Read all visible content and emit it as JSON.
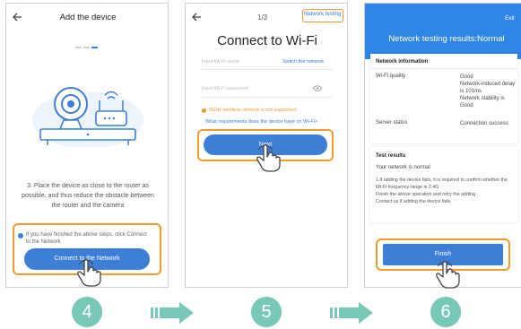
{
  "colors": {
    "accent": "#3d7fd6",
    "highlight": "#f29a2e",
    "step": "#78c8b8"
  },
  "screen1": {
    "back_icon": "back-arrow-icon",
    "title": "Add the device",
    "instruction": "3. Place the device as close to the router as possible, and thus reduce the obstacle between the router and the camera",
    "checkbox_label": "If you have finished the above steps, click Connect to the Network",
    "connect_button": "Connect to the Network"
  },
  "screen2": {
    "back_icon": "back-arrow-icon",
    "page_indicator": "1/3",
    "network_testing_link": "Network testing",
    "title": "Connect to Wi-Fi",
    "wifi_name_placeholder": "Input Wi-Fi name",
    "switch_network": "Switch the network",
    "wifi_password_placeholder": "Input Wi-Fi password",
    "warning": "5GHz wireless network is not supported",
    "requirements_link": "What requirements does the device have on Wi-Fi>",
    "next_button": "Next"
  },
  "screen3": {
    "exit": "Exit",
    "header_title": "Network testing results:Normal",
    "network_info_heading": "Network information",
    "wifi_quality_label": "Wi-Fi quality",
    "wifi_quality_value": "Good\nNetwork-induced delay is 101ms\nNetwork stability is Good",
    "server_status_label": "Server status",
    "server_status_value": "Connection success",
    "test_results_heading": "Test results",
    "network_normal": "Your network is normal",
    "advice": "1.If adding the device fails, it is required to confirm whether the Wi-Fi frequency range is 2.4G\nFinish the above operation and retry the adding\nContact us if adding the device fails",
    "finish_button": "Finish"
  },
  "steps": [
    "4",
    "5",
    "6"
  ]
}
